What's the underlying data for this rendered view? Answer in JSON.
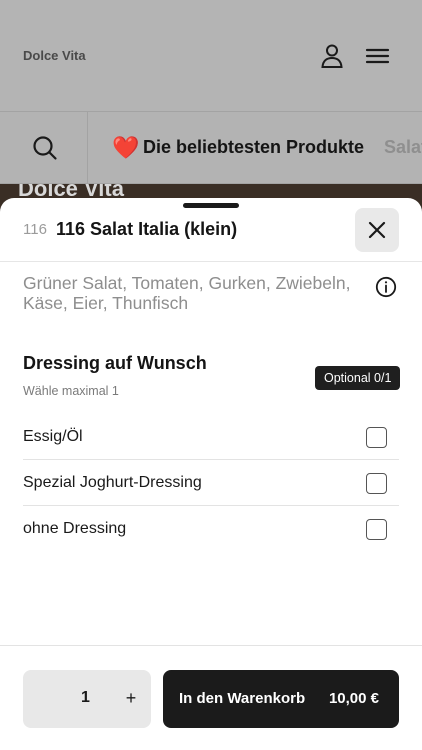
{
  "app": {
    "brand": "Dolce Vita",
    "icons": {
      "user": "user-icon",
      "menu": "hamburger-menu-icon",
      "search": "search-icon"
    }
  },
  "category_bar": {
    "active_emoji": "❤️",
    "active_label": "Die beliebtesten Produkte",
    "next_label": "Salat"
  },
  "hero": {
    "title": "Dolce Vita"
  },
  "sheet": {
    "product_number": "116",
    "product_title": "116 Salat Italia (klein)",
    "description": "Grüner Salat, Tomaten, Gurken, Zwiebeln, Käse, Eier, Thunfisch",
    "group": {
      "title": "Dressing auf Wunsch",
      "subtitle": "Wähle maximal 1",
      "badge": "Optional 0/1",
      "options": [
        {
          "label": "Essig/Öl",
          "checked": false
        },
        {
          "label": "Spezial Joghurt-Dressing",
          "checked": false
        },
        {
          "label": "ohne Dressing",
          "checked": false
        }
      ]
    },
    "footer": {
      "quantity": "1",
      "plus": "+",
      "cart_label": "In den Warenkorb",
      "price": "10,00 €"
    }
  },
  "colors": {
    "primary": "#1b1b1b",
    "overlay": "#b3b3b3",
    "heart": "#b00d12"
  }
}
